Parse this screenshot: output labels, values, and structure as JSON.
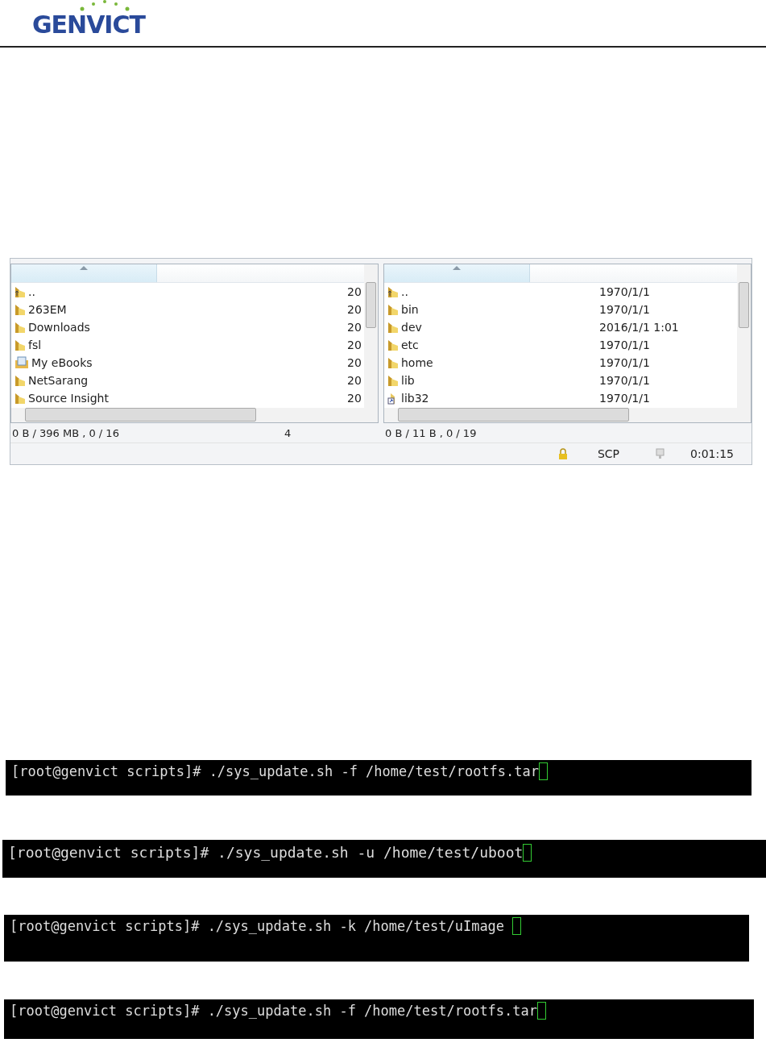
{
  "header": {
    "logo": "GENVICT"
  },
  "file_manager": {
    "panes": [
      {
        "rows": [
          {
            "kind": "up",
            "name": "..",
            "date": "20"
          },
          {
            "kind": "folder",
            "name": "263EM",
            "date": "20"
          },
          {
            "kind": "folder",
            "name": "Downloads",
            "date": "20"
          },
          {
            "kind": "folder",
            "name": "fsl",
            "date": "20"
          },
          {
            "kind": "library",
            "name": "My eBooks",
            "date": "20"
          },
          {
            "kind": "folder",
            "name": "NetSarang",
            "date": "20"
          },
          {
            "kind": "folder",
            "name": "Source Insight",
            "date": "20"
          }
        ],
        "status": "0 B / 396 MB ,  0 / 16",
        "status_extra": "4"
      },
      {
        "rows": [
          {
            "kind": "up",
            "name": "..",
            "date": "1970/1/1"
          },
          {
            "kind": "folder",
            "name": "bin",
            "date": "1970/1/1"
          },
          {
            "kind": "folder",
            "name": "dev",
            "date": "2016/1/1 1:01"
          },
          {
            "kind": "folder",
            "name": "etc",
            "date": "1970/1/1"
          },
          {
            "kind": "folder",
            "name": "home",
            "date": "1970/1/1"
          },
          {
            "kind": "folder",
            "name": "lib",
            "date": "1970/1/1"
          },
          {
            "kind": "link",
            "name": "lib32",
            "date": "1970/1/1"
          }
        ],
        "status": "0 B / 11 B ,  0 / 19"
      }
    ],
    "status_bar": {
      "protocol": "SCP",
      "elapsed": "0:01:15"
    }
  },
  "terminals": [
    {
      "command": "[root@genvict scripts]# ./sys_update.sh -f /home/test/rootfs.tar"
    },
    {
      "command": "[root@genvict scripts]# ./sys_update.sh -u /home/test/uboot"
    },
    {
      "command": "[root@genvict scripts]# ./sys_update.sh -k /home/test/uImage "
    },
    {
      "command": "[root@genvict scripts]# ./sys_update.sh -f /home/test/rootfs.tar"
    }
  ]
}
